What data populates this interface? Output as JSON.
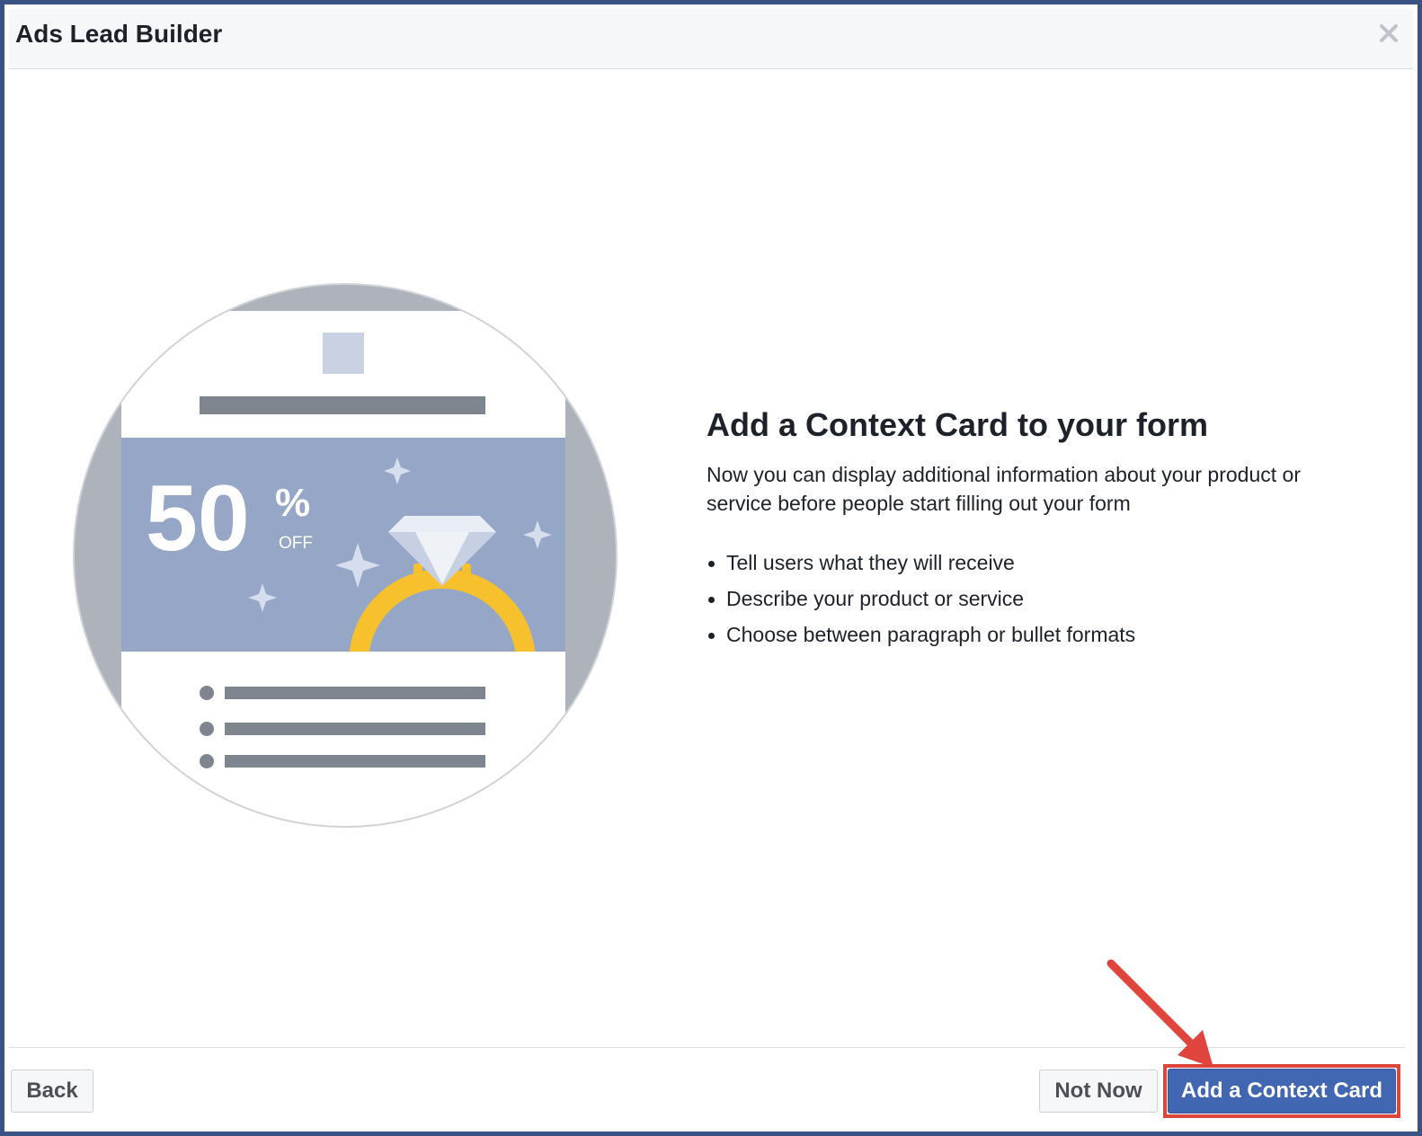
{
  "dialog": {
    "title": "Ads Lead Builder",
    "close_icon": "close-icon"
  },
  "illustration": {
    "discount_number": "50",
    "discount_percent": "%",
    "discount_off": "OFF",
    "icon": "diamond-ring-icon",
    "colors": {
      "circle": "#aeb3bb",
      "banner": "#95a6c7",
      "ring": "#f7c12d",
      "bars": "#7f858f"
    }
  },
  "content": {
    "heading": "Add a Context Card to your form",
    "description": "Now you can display additional information about your product or service before people start filling out your form",
    "bullets": [
      "Tell users what they will receive",
      "Describe your product or service",
      "Choose between paragraph or bullet formats"
    ]
  },
  "footer": {
    "back_label": "Back",
    "not_now_label": "Not Now",
    "primary_label": "Add a Context Card",
    "primary_color": "#4267b2",
    "highlight_color": "#e0453d"
  }
}
